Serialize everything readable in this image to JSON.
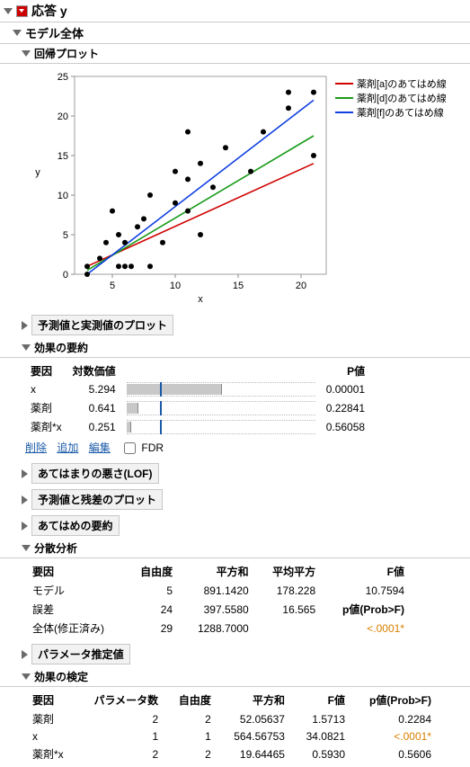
{
  "response": {
    "label": "応答 y"
  },
  "model_whole": {
    "label": "モデル全体"
  },
  "regression_plot": {
    "label": "回帰プロット",
    "xaxis": "x",
    "yaxis": "y",
    "legend": [
      {
        "name": "薬剤[a]のあてはめ線",
        "color": "#d00000"
      },
      {
        "name": "薬剤[d]のあてはめ線",
        "color": "#1a9b1a"
      },
      {
        "name": "薬剤[f]のあてはめ線",
        "color": "#1040e0"
      }
    ]
  },
  "actual_pred": {
    "label": "予測値と実測値のプロット"
  },
  "effect_summary": {
    "label": "効果の要約",
    "headers": {
      "source": "要因",
      "logworth": "対数価値",
      "pvalue": "P値"
    },
    "rows": [
      {
        "source": "x",
        "logworth": "5.294",
        "pvalue": "0.00001",
        "bar_pct": 50
      },
      {
        "source": "薬剤",
        "logworth": "0.641",
        "pvalue": "0.22841",
        "bar_pct": 6
      },
      {
        "source": "薬剤*x",
        "logworth": "0.251",
        "pvalue": "0.56058",
        "bar_pct": 2
      }
    ],
    "vline_pct": 18,
    "actions": {
      "remove": "削除",
      "add": "追加",
      "edit": "編集",
      "fdr": "FDR"
    }
  },
  "lof": {
    "label": "あてはまりの悪さ(LOF)"
  },
  "pred_resid": {
    "label": "予測値と残差のプロット"
  },
  "fit_summary": {
    "label": "あてはめの要約"
  },
  "anova": {
    "label": "分散分析",
    "headers": {
      "source": "要因",
      "df": "自由度",
      "ss": "平方和",
      "ms": "平均平方",
      "f": "F値"
    },
    "rows": [
      {
        "source": "モデル",
        "df": "5",
        "ss": "891.1420",
        "ms": "178.228",
        "f": "10.7594"
      },
      {
        "source": "誤差",
        "df": "24",
        "ss": "397.5580",
        "ms": "16.565",
        "f_label": "p値(Prob>F)"
      },
      {
        "source": "全体(修正済み)",
        "df": "29",
        "ss": "1288.7000",
        "p": "<.0001*"
      }
    ]
  },
  "param_est": {
    "label": "パラメータ推定値"
  },
  "effect_tests": {
    "label": "効果の検定",
    "headers": {
      "source": "要因",
      "nparm": "パラメータ数",
      "df": "自由度",
      "ss": "平方和",
      "f": "F値",
      "p": "p値(Prob>F)"
    },
    "rows": [
      {
        "source": "薬剤",
        "nparm": "2",
        "df": "2",
        "ss": "52.05637",
        "f": "1.5713",
        "p": "0.2284",
        "orange": false
      },
      {
        "source": "x",
        "nparm": "1",
        "df": "1",
        "ss": "564.56753",
        "f": "34.0821",
        "p": "<.0001*",
        "orange": true
      },
      {
        "source": "薬剤*x",
        "nparm": "2",
        "df": "2",
        "ss": "19.64465",
        "f": "0.5930",
        "p": "0.5606",
        "orange": false
      }
    ]
  },
  "chart_data": {
    "type": "scatter_with_lines",
    "title": "",
    "xlabel": "x",
    "ylabel": "y",
    "xlim": [
      2,
      22
    ],
    "ylim": [
      0,
      25
    ],
    "xticks": [
      5,
      10,
      15,
      20
    ],
    "yticks": [
      0,
      5,
      10,
      15,
      20,
      25
    ],
    "points": [
      {
        "x": 3,
        "y": 0
      },
      {
        "x": 3,
        "y": 1
      },
      {
        "x": 4,
        "y": 2
      },
      {
        "x": 4.5,
        "y": 4
      },
      {
        "x": 5,
        "y": 8
      },
      {
        "x": 5.5,
        "y": 1
      },
      {
        "x": 5.5,
        "y": 5
      },
      {
        "x": 6,
        "y": 1
      },
      {
        "x": 6,
        "y": 4
      },
      {
        "x": 6.5,
        "y": 1
      },
      {
        "x": 7,
        "y": 6
      },
      {
        "x": 7.5,
        "y": 7
      },
      {
        "x": 8,
        "y": 1
      },
      {
        "x": 8,
        "y": 10
      },
      {
        "x": 9,
        "y": 4
      },
      {
        "x": 10,
        "y": 9
      },
      {
        "x": 10,
        "y": 13
      },
      {
        "x": 11,
        "y": 8
      },
      {
        "x": 11,
        "y": 12
      },
      {
        "x": 11,
        "y": 18
      },
      {
        "x": 12,
        "y": 5
      },
      {
        "x": 12,
        "y": 14
      },
      {
        "x": 13,
        "y": 11
      },
      {
        "x": 14,
        "y": 16
      },
      {
        "x": 16,
        "y": 13
      },
      {
        "x": 17,
        "y": 18
      },
      {
        "x": 19,
        "y": 21
      },
      {
        "x": 19,
        "y": 23
      },
      {
        "x": 21,
        "y": 23
      },
      {
        "x": 21,
        "y": 15
      }
    ],
    "lines": [
      {
        "name": "薬剤[a]",
        "color": "#d00000",
        "x1": 3,
        "y1": 1.0,
        "x2": 21,
        "y2": 14.0
      },
      {
        "name": "薬剤[d]",
        "color": "#1a9b1a",
        "x1": 3,
        "y1": 0.5,
        "x2": 21,
        "y2": 17.5
      },
      {
        "name": "薬剤[f]",
        "color": "#1040e0",
        "x1": 3,
        "y1": 0.0,
        "x2": 21,
        "y2": 22.0
      }
    ]
  }
}
